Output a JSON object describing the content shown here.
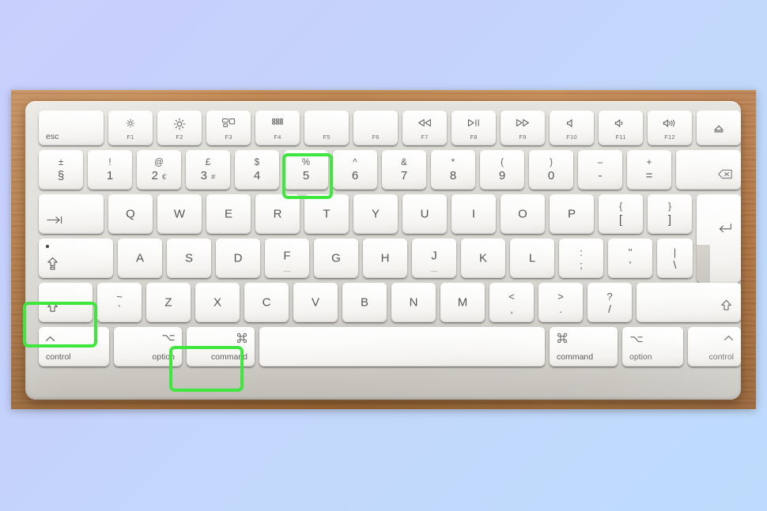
{
  "scene": {
    "subject": "Apple Magic Keyboard (ISO / UK layout) on a wooden desk",
    "background_top_color": "#c8cffc",
    "background_bottom_color": "#bddbfc",
    "desk_color": "#b97a3d",
    "keyboard_body_color": "#d8d6d0",
    "key_cap_color": "#fbfbf9",
    "key_text_color": "#5a5a5a",
    "highlight_color": "#3ee63e",
    "highlighted_keys": [
      "shift-left",
      "command-left",
      "5"
    ],
    "shortcut": "Shift + Command + 5"
  },
  "rows": {
    "function_row": [
      {
        "id": "esc",
        "label": "esc"
      },
      {
        "id": "f1",
        "glyph": "brightness-down-icon",
        "label": "F1"
      },
      {
        "id": "f2",
        "glyph": "brightness-up-icon",
        "label": "F2"
      },
      {
        "id": "f3",
        "glyph": "mission-control-icon",
        "label": "F3"
      },
      {
        "id": "f4",
        "glyph": "launchpad-icon",
        "label": "F4"
      },
      {
        "id": "f5",
        "glyph": "",
        "label": "F5"
      },
      {
        "id": "f6",
        "glyph": "",
        "label": "F6"
      },
      {
        "id": "f7",
        "glyph": "rewind-icon",
        "label": "F7"
      },
      {
        "id": "f8",
        "glyph": "play-pause-icon",
        "label": "F8"
      },
      {
        "id": "f9",
        "glyph": "fast-forward-icon",
        "label": "F9"
      },
      {
        "id": "f10",
        "glyph": "mute-icon",
        "label": "F10"
      },
      {
        "id": "f11",
        "glyph": "volume-down-icon",
        "label": "F11"
      },
      {
        "id": "f12",
        "glyph": "volume-up-icon",
        "label": "F12"
      },
      {
        "id": "eject",
        "glyph": "eject-icon",
        "label": ""
      }
    ],
    "number_row": [
      {
        "id": "section",
        "top": "±",
        "bottom": "§"
      },
      {
        "id": "1",
        "top": "!",
        "bottom": "1"
      },
      {
        "id": "2",
        "top": "@",
        "bottom": "2",
        "extra": "€"
      },
      {
        "id": "3",
        "top": "£",
        "bottom": "3",
        "extra": "#"
      },
      {
        "id": "4",
        "top": "$",
        "bottom": "4"
      },
      {
        "id": "5",
        "top": "%",
        "bottom": "5",
        "highlight": true
      },
      {
        "id": "6",
        "top": "^",
        "bottom": "6"
      },
      {
        "id": "7",
        "top": "&",
        "bottom": "7"
      },
      {
        "id": "8",
        "top": "*",
        "bottom": "8"
      },
      {
        "id": "9",
        "top": "(",
        "bottom": "9"
      },
      {
        "id": "0",
        "top": ")",
        "bottom": "0"
      },
      {
        "id": "minus",
        "top": "–",
        "bottom": "-"
      },
      {
        "id": "equal",
        "top": "+",
        "bottom": "="
      },
      {
        "id": "delete",
        "glyph": "delete-icon"
      }
    ],
    "top_row": [
      {
        "id": "tab",
        "glyph": "tab-icon"
      },
      {
        "id": "q",
        "label": "Q"
      },
      {
        "id": "w",
        "label": "W"
      },
      {
        "id": "e",
        "label": "E"
      },
      {
        "id": "r",
        "label": "R"
      },
      {
        "id": "t",
        "label": "T"
      },
      {
        "id": "y",
        "label": "Y"
      },
      {
        "id": "u",
        "label": "U"
      },
      {
        "id": "i",
        "label": "I"
      },
      {
        "id": "o",
        "label": "O"
      },
      {
        "id": "p",
        "label": "P"
      },
      {
        "id": "bracket-left",
        "top": "{",
        "bottom": "["
      },
      {
        "id": "bracket-right",
        "top": "}",
        "bottom": "]"
      },
      {
        "id": "return",
        "glyph": "return-icon"
      }
    ],
    "home_row": [
      {
        "id": "caps-lock",
        "glyph": "caps-lock-icon"
      },
      {
        "id": "a",
        "label": "A"
      },
      {
        "id": "s",
        "label": "S"
      },
      {
        "id": "d",
        "label": "D"
      },
      {
        "id": "f",
        "label": "F",
        "homing": true
      },
      {
        "id": "g",
        "label": "G"
      },
      {
        "id": "h",
        "label": "H"
      },
      {
        "id": "j",
        "label": "J",
        "homing": true
      },
      {
        "id": "k",
        "label": "K"
      },
      {
        "id": "l",
        "label": "L"
      },
      {
        "id": "semicolon",
        "top": ":",
        "bottom": ";"
      },
      {
        "id": "quote",
        "top": "\"",
        "bottom": "'"
      },
      {
        "id": "backslash",
        "top": "|",
        "bottom": "\\"
      }
    ],
    "shift_row": [
      {
        "id": "shift-left",
        "glyph": "shift-icon",
        "highlight": true
      },
      {
        "id": "tilde",
        "top": "~",
        "bottom": "`"
      },
      {
        "id": "z",
        "label": "Z"
      },
      {
        "id": "x",
        "label": "X"
      },
      {
        "id": "c",
        "label": "C"
      },
      {
        "id": "v",
        "label": "V"
      },
      {
        "id": "b",
        "label": "B"
      },
      {
        "id": "n",
        "label": "N"
      },
      {
        "id": "m",
        "label": "M"
      },
      {
        "id": "comma",
        "top": "<",
        "bottom": ","
      },
      {
        "id": "period",
        "top": ">",
        "bottom": "."
      },
      {
        "id": "slash",
        "top": "?",
        "bottom": "/"
      },
      {
        "id": "shift-right",
        "glyph": "shift-icon"
      }
    ],
    "bottom_row": [
      {
        "id": "control-left",
        "glyph": "control-icon",
        "label": "control"
      },
      {
        "id": "option-left",
        "glyph": "option-icon",
        "label": "option"
      },
      {
        "id": "command-left",
        "glyph": "command-icon",
        "label": "command",
        "highlight": true
      },
      {
        "id": "space",
        "label": ""
      },
      {
        "id": "command-right",
        "glyph": "command-icon",
        "label": "command"
      },
      {
        "id": "option-right",
        "glyph": "option-icon",
        "label": "option"
      },
      {
        "id": "control-right",
        "glyph": "control-icon",
        "label": "control"
      }
    ]
  },
  "glyphs": {
    "brightness-down-icon": "☼",
    "brightness-up-icon": "☀",
    "rewind-icon": "◁◁",
    "play-pause-icon": "▷‖",
    "fast-forward-icon": "▷▷",
    "mute-icon": "◁",
    "volume-down-icon": "◁)",
    "volume-up-icon": "◁))",
    "eject-icon": "⏏",
    "delete-icon": "⌫",
    "tab-icon": "⇥",
    "return-icon": "↵",
    "caps-lock-icon": "⇪",
    "shift-icon": "⇧",
    "control-icon": "˄",
    "option-icon": "⌥",
    "command-icon": "⌘"
  }
}
